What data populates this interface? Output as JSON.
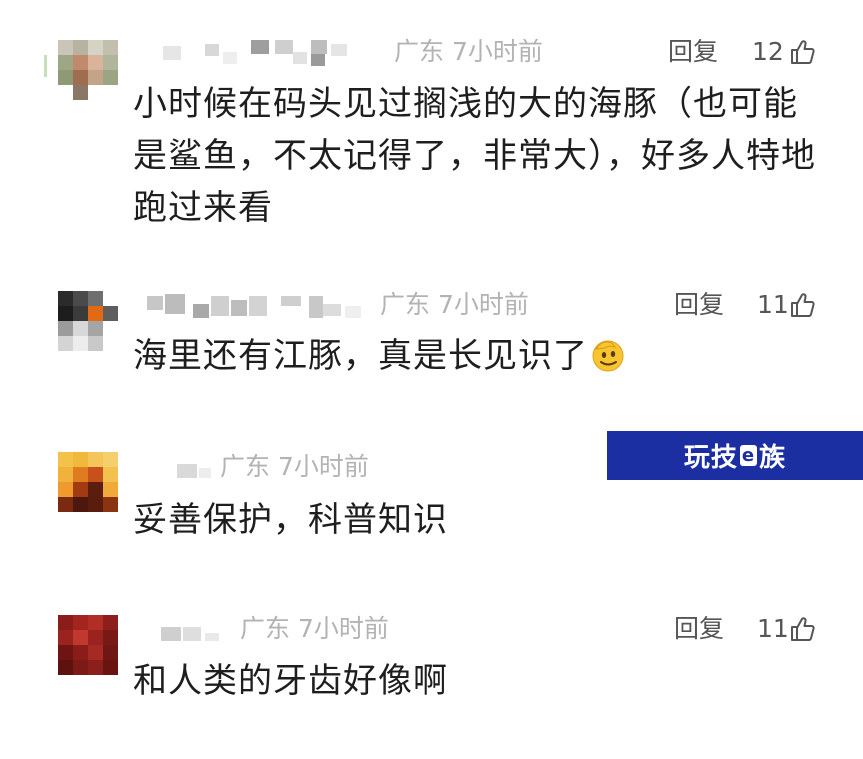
{
  "comments": [
    {
      "location": "广东",
      "time": "7小时前",
      "reply_label": "回复",
      "likes": "12",
      "text": "小时候在码头见过搁浅的大的海豚（也可能是鲨鱼，不太记得了，非常大），好多人特地跑过来看"
    },
    {
      "location": "广东",
      "time": "7小时前",
      "reply_label": "回复",
      "likes": "11",
      "text": "海里还有江豚，真是长见识了"
    },
    {
      "location": "广东",
      "time": "7小时前",
      "text": "妥善保护，科普知识"
    },
    {
      "location": "广东",
      "time": "7小时前",
      "reply_label": "回复",
      "likes": "11",
      "text": "和人类的牙齿好像啊"
    }
  ],
  "watermark": {
    "text_a": "玩技",
    "text_e": "e",
    "text_b": "族"
  },
  "icons": {
    "like": "thumbs-up-icon",
    "emoji": "salute-face-emoji"
  },
  "colors": {
    "meta_text": "#b3b3b3",
    "body_text": "#1e1e1e",
    "action_text": "#555555",
    "watermark_bg": "#1b2fa3"
  }
}
